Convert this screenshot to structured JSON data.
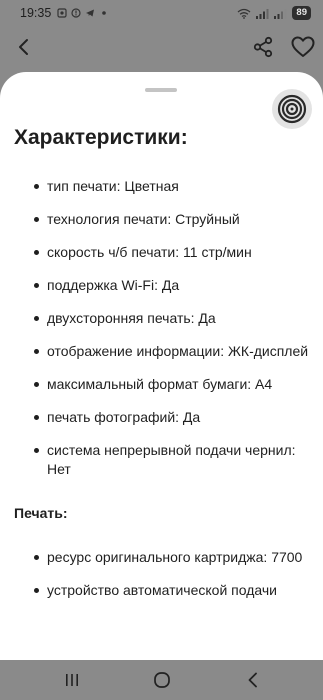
{
  "status_bar": {
    "time": "19:35",
    "battery": "89"
  },
  "sheet": {
    "title": "Характеристики:",
    "specs": [
      "тип печати: Цветная",
      "технология печати: Струйный",
      "скорость ч/б печати: 11 стр/мин",
      "поддержка Wi-Fi: Да",
      "двухсторонняя печать: Да",
      "отображение информации: ЖК-дисплей",
      "максимальный формат бумаги: A4",
      "печать фотографий: Да",
      "система непрерывной подачи чернил: Нет"
    ],
    "print_section_title": "Печать:",
    "print_specs": [
      "ресурс оригинального картриджа: 7700",
      "устройство автоматической подачи"
    ]
  },
  "icons": {
    "back": "chevron-left-icon",
    "share": "share-icon",
    "favorite": "heart-icon",
    "target": "target-icon",
    "nav_recents": "recents-icon",
    "nav_home": "home-icon",
    "nav_back": "nav-back-icon"
  },
  "colors": {
    "overlay": "#8a8a8a",
    "sheet": "#ffffff",
    "text": "#1f1f1f"
  }
}
